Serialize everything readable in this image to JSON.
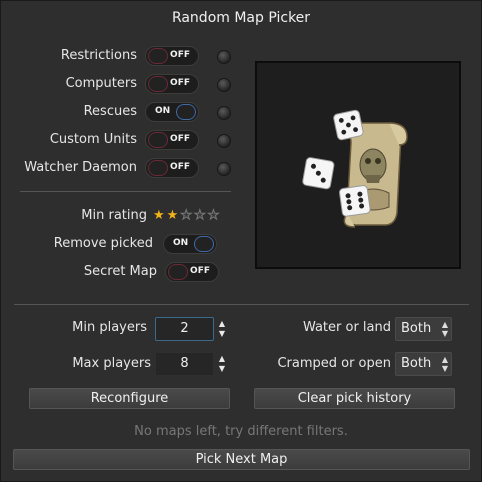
{
  "window": {
    "title": "Random Map Picker"
  },
  "filters": [
    {
      "label": "Restrictions",
      "toggle": "OFF",
      "state": "off"
    },
    {
      "label": "Computers",
      "toggle": "OFF",
      "state": "off"
    },
    {
      "label": "Rescues",
      "toggle": "ON",
      "state": "on"
    },
    {
      "label": "Custom Units",
      "toggle": "OFF",
      "state": "off"
    },
    {
      "label": "Watcher Daemon",
      "toggle": "OFF",
      "state": "off"
    }
  ],
  "min_rating": {
    "label": "Min rating",
    "value": 2,
    "max": 5
  },
  "remove_picked": {
    "label": "Remove picked",
    "toggle": "ON",
    "state": "on"
  },
  "secret_map": {
    "label": "Secret Map",
    "toggle": "OFF",
    "state": "off"
  },
  "min_players": {
    "label": "Min players",
    "value": "2"
  },
  "max_players": {
    "label": "Max players",
    "value": "8"
  },
  "water_or_land": {
    "label": "Water or land",
    "selected": "Both"
  },
  "cramped_or_open": {
    "label": "Cramped or open",
    "selected": "Both"
  },
  "buttons": {
    "reconfigure": "Reconfigure",
    "clear_history": "Clear pick history",
    "pick_next": "Pick Next Map"
  },
  "status": "No maps left, try different filters.",
  "icons": {
    "spinner_up": "▲",
    "spinner_down": "▼",
    "star": "★"
  },
  "colors": {
    "star_on": "#f2b21a",
    "toggle_on": "#3f6aa8",
    "toggle_off": "#6b2a36"
  }
}
